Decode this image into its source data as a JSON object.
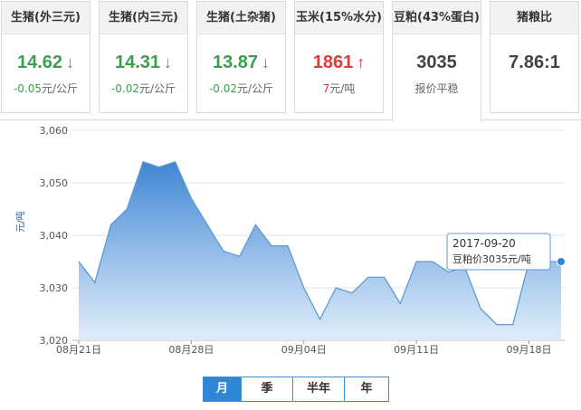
{
  "tabs": [
    {
      "title": "生猪(外三元)",
      "price": "14.62",
      "trend": "down",
      "arrow": "↓",
      "change": "-0.05",
      "unit": "元/公斤"
    },
    {
      "title": "生猪(内三元)",
      "price": "14.31",
      "trend": "down",
      "arrow": "↓",
      "change": "-0.02",
      "unit": "元/公斤"
    },
    {
      "title": "生猪(土杂猪)",
      "price": "13.87",
      "trend": "down",
      "arrow": "↓",
      "change": "-0.02",
      "unit": "元/公斤"
    },
    {
      "title": "玉米(15%水分)",
      "price": "1861",
      "trend": "up",
      "arrow": "↑",
      "change": "7",
      "unit": "元/吨"
    },
    {
      "title": "豆粕(43%蛋白)",
      "price": "3035",
      "trend": "flat",
      "arrow": "",
      "change": "",
      "unit": "报价平稳"
    },
    {
      "title": "猪粮比",
      "price": "7.86:1",
      "trend": "flat",
      "arrow": "",
      "change": "",
      "unit": ""
    }
  ],
  "colors": {
    "down": "#3aa14a",
    "up": "#e23a3a",
    "line": "#5b9bd5",
    "fill_top": "#3f86d4",
    "fill_bottom": "#dcebf9",
    "accent": "#2f86d6"
  },
  "period_buttons": [
    "月",
    "季",
    "半年",
    "年"
  ],
  "active_period": "月",
  "chart_data": {
    "type": "area",
    "ylabel": "元/吨",
    "ylim": [
      3020,
      3060
    ],
    "yticks": [
      "3,020",
      "3,030",
      "3,040",
      "3,050",
      "3,060"
    ],
    "xticks": [
      "08月21日",
      "08月28日",
      "09月04日",
      "09月11日",
      "09月18日"
    ],
    "grid": true,
    "series": [
      {
        "x": [
          "2017-08-21",
          "2017-08-22",
          "2017-08-23",
          "2017-08-24",
          "2017-08-25",
          "2017-08-26",
          "2017-08-27",
          "2017-08-28",
          "2017-08-29",
          "2017-08-30",
          "2017-08-31",
          "2017-09-01",
          "2017-09-02",
          "2017-09-03",
          "2017-09-04",
          "2017-09-05",
          "2017-09-06",
          "2017-09-07",
          "2017-09-08",
          "2017-09-09",
          "2017-09-10",
          "2017-09-11",
          "2017-09-12",
          "2017-09-13",
          "2017-09-14",
          "2017-09-15",
          "2017-09-16",
          "2017-09-17",
          "2017-09-18",
          "2017-09-19",
          "2017-09-20"
        ],
        "values": [
          3035,
          3031,
          3042,
          3045,
          3054,
          3053,
          3054,
          3047,
          3042,
          3037,
          3036,
          3042,
          3038,
          3038,
          3030,
          3024,
          3030,
          3029,
          3032,
          3032,
          3027,
          3035,
          3035,
          3033,
          3034,
          3026,
          3023,
          3023,
          3035,
          3035,
          3035
        ]
      }
    ],
    "tooltip": {
      "date": "2017-09-20",
      "text": "豆粕价3035元/吨"
    }
  }
}
